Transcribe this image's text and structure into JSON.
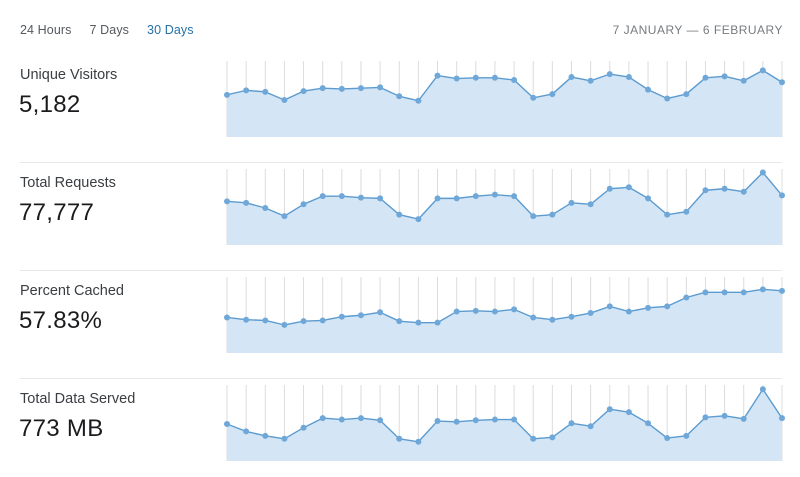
{
  "tabs": [
    {
      "label": "24 Hours",
      "active": false
    },
    {
      "label": "7 Days",
      "active": false
    },
    {
      "label": "30 Days",
      "active": true
    }
  ],
  "date_range": "7 JANUARY — 6 FEBRUARY",
  "colors": {
    "line": "#5b9bd0",
    "fill": "#d4e6f5",
    "marker": "#6fa8d8",
    "gridline": "#dcdcdf",
    "tab_active": "#2671a8"
  },
  "metrics": [
    {
      "label": "Unique Visitors",
      "value": "5,182"
    },
    {
      "label": "Total Requests",
      "value": "77,777"
    },
    {
      "label": "Percent Cached",
      "value": "57.83%"
    },
    {
      "label": "Total Data Served",
      "value": "773 MB"
    }
  ],
  "chart_data": [
    {
      "type": "area",
      "title": "",
      "xlabel": "",
      "ylabel": "",
      "grid": "vertical",
      "values": [
        57,
        63,
        61,
        50,
        62,
        66,
        65,
        66,
        67,
        55,
        49,
        83,
        79,
        80,
        80,
        77,
        53,
        58,
        81,
        76,
        85,
        81,
        64,
        52,
        58,
        80,
        82,
        76,
        90,
        74
      ],
      "ylim": [
        0,
        100
      ]
    },
    {
      "type": "area",
      "title": "",
      "xlabel": "",
      "ylabel": "",
      "grid": "vertical",
      "values": [
        59,
        57,
        50,
        39,
        55,
        66,
        66,
        64,
        63,
        41,
        35,
        63,
        63,
        66,
        68,
        66,
        39,
        41,
        57,
        55,
        76,
        78,
        63,
        41,
        45,
        74,
        76,
        72,
        98,
        67
      ],
      "ylim": [
        0,
        100
      ]
    },
    {
      "type": "area",
      "title": "",
      "xlabel": "",
      "ylabel": "",
      "grid": "vertical",
      "values": [
        48,
        45,
        44,
        38,
        43,
        44,
        49,
        51,
        55,
        43,
        41,
        41,
        56,
        57,
        56,
        59,
        48,
        45,
        49,
        54,
        63,
        56,
        61,
        63,
        75,
        82,
        82,
        82,
        86,
        84
      ],
      "ylim": [
        0,
        100
      ]
    },
    {
      "type": "area",
      "title": "",
      "xlabel": "",
      "ylabel": "",
      "grid": "vertical",
      "values": [
        50,
        40,
        34,
        30,
        45,
        58,
        56,
        58,
        55,
        30,
        26,
        54,
        53,
        55,
        56,
        56,
        30,
        32,
        51,
        47,
        70,
        66,
        51,
        31,
        34,
        59,
        61,
        57,
        97,
        58
      ],
      "ylim": [
        0,
        100
      ]
    }
  ]
}
